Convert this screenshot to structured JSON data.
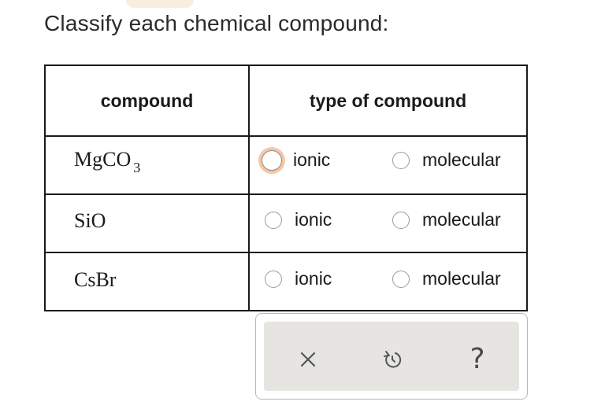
{
  "prompt": "Classify each chemical compound:",
  "table": {
    "headers": {
      "compound": "compound",
      "type": "type of compound"
    },
    "rows": [
      {
        "formula": "MgCO",
        "subscript": "3",
        "option_a": "ionic",
        "option_b": "molecular"
      },
      {
        "formula": "SiO",
        "subscript": "",
        "option_a": "ionic",
        "option_b": "molecular"
      },
      {
        "formula": "CsBr",
        "subscript": "",
        "option_a": "ionic",
        "option_b": "molecular"
      }
    ]
  },
  "toolbar": {
    "clear_icon": "close-icon",
    "undo_icon": "undo-icon",
    "help_label": "?"
  },
  "colors": {
    "focus_ring": "#f5c7a6",
    "toolbar_bg": "#e6e5e1"
  }
}
